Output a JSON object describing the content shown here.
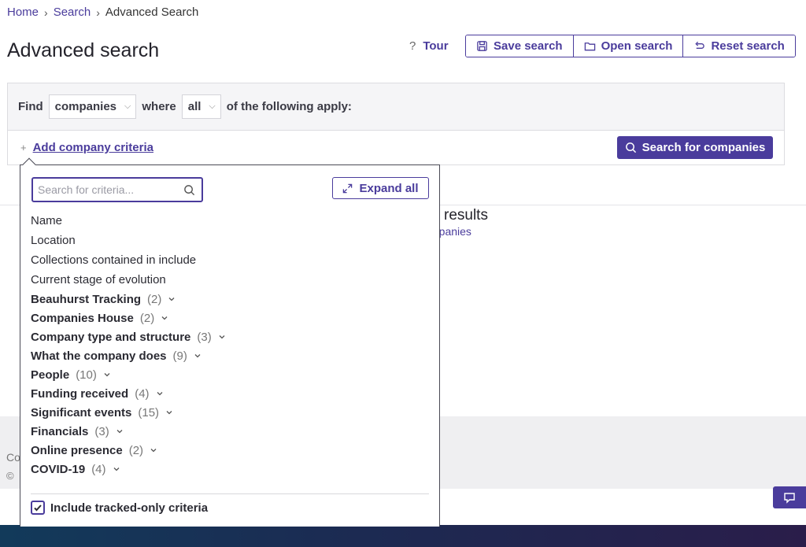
{
  "breadcrumb": {
    "home": "Home",
    "search": "Search",
    "current": "Advanced Search"
  },
  "page": {
    "title": "Advanced search"
  },
  "header": {
    "tour_label": "Tour",
    "tour_icon": "question-icon",
    "save_label": "Save search",
    "open_label": "Open search",
    "reset_label": "Reset search"
  },
  "find": {
    "find_label": "Find",
    "entity_value": "companies",
    "where_label": "where",
    "match_value": "all",
    "suffix": "of the following apply:"
  },
  "actions": {
    "add_criteria_label": "Add company criteria",
    "search_button_label": "Search for companies"
  },
  "results": {
    "title_fragment": "results",
    "link_fragment": "mpanies"
  },
  "footer": {
    "text1": "Co",
    "text2": "©"
  },
  "dropdown": {
    "search_placeholder": "Search for criteria...",
    "expand_all_label": "Expand all",
    "items": [
      "Name",
      "Location",
      "Collections contained in include",
      "Current stage of evolution"
    ],
    "groups": [
      {
        "name": "Beauhurst Tracking",
        "count": "(2)"
      },
      {
        "name": "Companies House",
        "count": "(2)"
      },
      {
        "name": "Company type and structure",
        "count": "(3)"
      },
      {
        "name": "What the company does",
        "count": "(9)"
      },
      {
        "name": "People",
        "count": "(10)"
      },
      {
        "name": "Funding received",
        "count": "(4)"
      },
      {
        "name": "Significant events",
        "count": "(15)"
      },
      {
        "name": "Financials",
        "count": "(3)"
      },
      {
        "name": "Online presence",
        "count": "(2)"
      },
      {
        "name": "COVID-19",
        "count": "(4)"
      }
    ],
    "tracked_only_label": "Include tracked-only criteria",
    "tracked_only_checked": true
  },
  "colors": {
    "accent": "#4a3c9c",
    "panel_bg": "#f5f5f7",
    "footer_bg": "#efeff1"
  }
}
